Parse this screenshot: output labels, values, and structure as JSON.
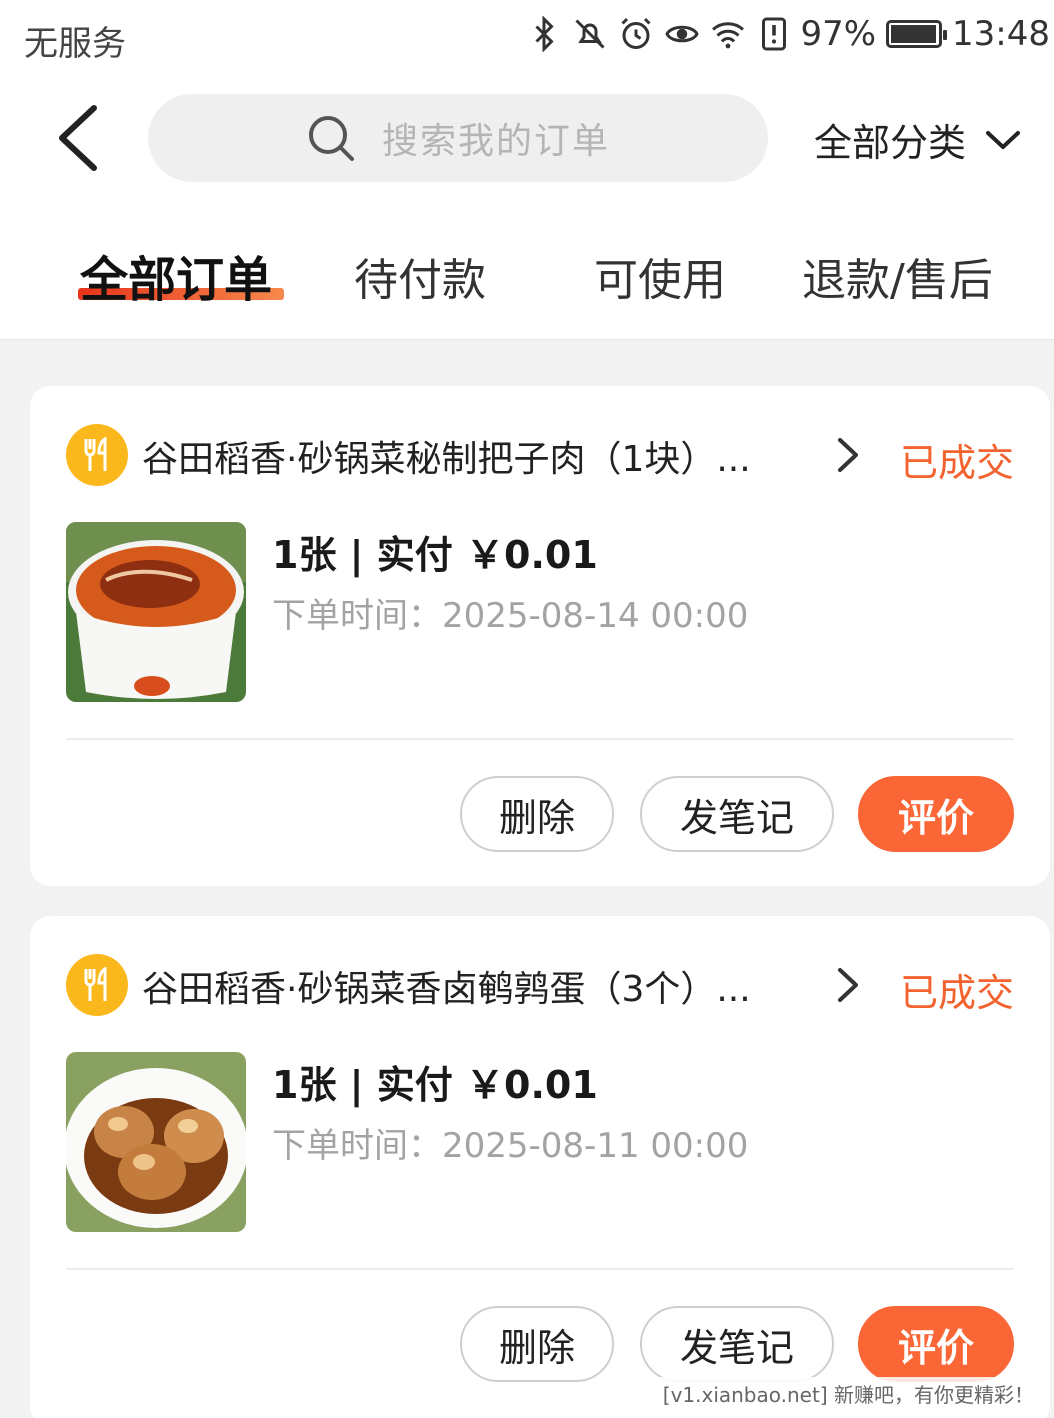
{
  "status_bar": {
    "carrier": "无服务",
    "battery_percent": "97%",
    "time": "13:48",
    "battery_level": 0.97,
    "icons": [
      "bluetooth-icon",
      "mute-icon",
      "alarm-icon",
      "eye-icon",
      "wifi-icon",
      "storage-alert-icon",
      "battery-icon"
    ]
  },
  "header": {
    "search_placeholder": "搜索我的订单",
    "category_label": "全部分类"
  },
  "tabs": [
    {
      "label": "全部订单",
      "active": true
    },
    {
      "label": "待付款",
      "active": false
    },
    {
      "label": "可使用",
      "active": false
    },
    {
      "label": "退款/售后",
      "active": false
    }
  ],
  "orders": [
    {
      "shop_title": "谷田稻香·砂锅菜秘制把子肉（1块）...",
      "status": "已成交",
      "summary": "1张 | 实付 ￥0.01",
      "order_time": "下单时间：2025-08-14 00:00",
      "image": "braised-pork-photo",
      "actions": {
        "delete": "删除",
        "note": "发笔记",
        "review": "评价"
      }
    },
    {
      "shop_title": "谷田稻香·砂锅菜香卤鹌鹑蛋（3个）...",
      "status": "已成交",
      "summary": "1张 | 实付 ￥0.01",
      "order_time": "下单时间：2025-08-11 00:00",
      "image": "quail-eggs-photo",
      "actions": {
        "delete": "删除",
        "note": "发笔记",
        "review": "评价"
      }
    }
  ],
  "watermark": "[v1.xianbao.net] 新赚吧，有你更精彩！",
  "colors": {
    "accent": "#fa6636",
    "status": "#f3632f",
    "shop_logo": "#fbb81c"
  }
}
